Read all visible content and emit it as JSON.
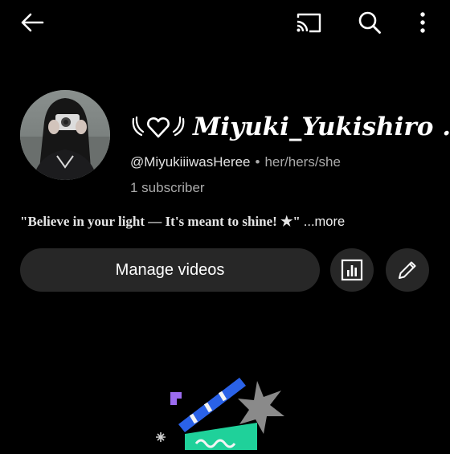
{
  "topbar": {
    "icons": [
      "back-arrow-icon",
      "cast-icon",
      "search-icon",
      "more-vert-icon"
    ]
  },
  "channel": {
    "name": "Miyuki_Yukishiro ..",
    "name_decoration": "winged-heart-icon",
    "handle": "@MiyukiiiwasHeree",
    "separator": "•",
    "pronouns": "her/hers/she",
    "subscribers": "1 subscriber",
    "description": "\"Believe in your light — It's meant to shine! ★\"",
    "more_label": "...more"
  },
  "actions": {
    "manage_label": "Manage videos",
    "analytics_icon": "analytics-icon",
    "edit_icon": "pencil-icon"
  },
  "colors": {
    "background": "#000000",
    "button_bg": "#272727",
    "secondary_text": "#aaaaaa",
    "illustration_blue": "#2a62e8",
    "illustration_green": "#1fd19a",
    "illustration_purple": "#9c6cf0"
  }
}
